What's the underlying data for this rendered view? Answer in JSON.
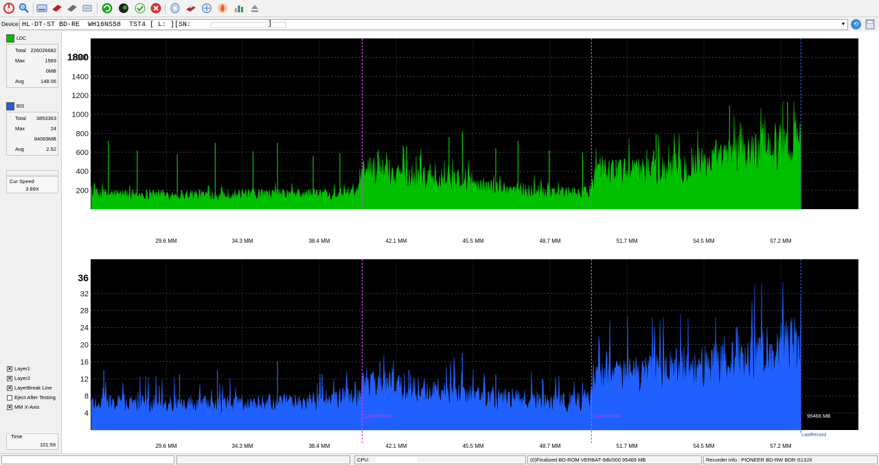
{
  "toolbar": {
    "buttons": [
      {
        "icon": "power-icon",
        "color": "#d43a2a"
      },
      {
        "icon": "find-icon",
        "color": "#3568c8"
      },
      {
        "icon": "drive-icon",
        "color": "#5577aa"
      },
      {
        "icon": "burn-disc-icon",
        "color": "#c02020"
      },
      {
        "icon": "erase-disc-icon",
        "color": "#707070"
      },
      {
        "icon": "copy-icon",
        "color": "#5a7fa8"
      },
      {
        "icon": "refresh-icon",
        "color": "#22a020"
      },
      {
        "icon": "earth-icon",
        "color": "#222222"
      },
      {
        "icon": "verify-icon",
        "color": "#3a9c3a"
      },
      {
        "icon": "stop-icon",
        "color": "#d83030"
      },
      {
        "icon": "disc-info-icon",
        "color": "#5580c0"
      },
      {
        "icon": "disc-quality-icon",
        "color": "#b03030"
      },
      {
        "icon": "scan-icon",
        "color": "#3070c0"
      },
      {
        "icon": "burn-icon",
        "color": "#e06020"
      },
      {
        "icon": "chart-icon",
        "color": "#e0a020"
      },
      {
        "icon": "eject-icon",
        "color": "#909090"
      }
    ]
  },
  "device": {
    "label": "Device:",
    "value": "HL-DT-ST BD-RE  WH16NS58  TST4 [ L: ][SN:",
    "close": "]"
  },
  "sidebar": {
    "ldc": {
      "label": "LDC",
      "color": "#00c000",
      "rows": [
        {
          "label": "Total",
          "value": "226026682"
        },
        {
          "label": "Max",
          "value": "1569"
        },
        {
          "label": "",
          "value": "0MB"
        },
        {
          "label": "Avg",
          "value": "148.06"
        }
      ]
    },
    "bis": {
      "label": "BIS",
      "color": "#2060e0",
      "rows": [
        {
          "label": "Total",
          "value": "3853363"
        },
        {
          "label": "Max",
          "value": "24"
        },
        {
          "label": "",
          "value": "84069MB"
        },
        {
          "label": "Avg",
          "value": "2.52"
        }
      ]
    },
    "cur_speed": {
      "label": "Cur Speed",
      "value": "3.89X"
    },
    "checkboxes": [
      {
        "label": "Layer1",
        "checked": true
      },
      {
        "label": "Layer2",
        "checked": true
      },
      {
        "label": "LayerBreak Line",
        "checked": true
      },
      {
        "label": "Eject After Testing",
        "checked": false
      },
      {
        "label": "MM X-Axis",
        "checked": true
      }
    ],
    "time": {
      "label": "Time",
      "value": "101:59"
    }
  },
  "chart_data": [
    {
      "type": "area",
      "series": [
        {
          "name": "LDC",
          "color": "#00c000"
        }
      ],
      "x_tick_labels": [
        "29.6 MM",
        "34.3 MM",
        "38.4 MM",
        "42.1 MM",
        "45.5 MM",
        "48.7 MM",
        "51.7 MM",
        "54.5 MM",
        "57.2 MM"
      ],
      "y_ticks": [
        200,
        400,
        600,
        800,
        1000,
        1200,
        1400,
        1600
      ],
      "y_top_label": "1800",
      "ylim": [
        0,
        1800
      ],
      "grid": true,
      "layer_breaks_mm": [
        38.4,
        48.7
      ],
      "last_record_mm": 58.1,
      "profile": {
        "x_mm": [
          25.6,
          28.0,
          32.0,
          36.0,
          38.2,
          38.5,
          40.0,
          42.0,
          44.0,
          46.0,
          48.6,
          48.9,
          50.0,
          52.0,
          54.0,
          56.0,
          58.1
        ],
        "baseline": [
          125,
          120,
          118,
          122,
          130,
          330,
          290,
          230,
          180,
          150,
          130,
          340,
          300,
          320,
          380,
          470,
          560
        ],
        "peaks": [
          {
            "x_mm": 27.0,
            "y": 720
          },
          {
            "x_mm": 28.3,
            "y": 620
          },
          {
            "x_mm": 30.1,
            "y": 580
          },
          {
            "x_mm": 31.8,
            "y": 700
          },
          {
            "x_mm": 33.5,
            "y": 610
          },
          {
            "x_mm": 34.6,
            "y": 700
          },
          {
            "x_mm": 36.2,
            "y": 560
          },
          {
            "x_mm": 37.4,
            "y": 590
          },
          {
            "x_mm": 39.1,
            "y": 600
          },
          {
            "x_mm": 40.4,
            "y": 660
          },
          {
            "x_mm": 41.0,
            "y": 560
          },
          {
            "x_mm": 42.3,
            "y": 760
          },
          {
            "x_mm": 42.9,
            "y": 820
          },
          {
            "x_mm": 44.4,
            "y": 640
          },
          {
            "x_mm": 45.4,
            "y": 720
          },
          {
            "x_mm": 46.8,
            "y": 620
          },
          {
            "x_mm": 48.3,
            "y": 600
          },
          {
            "x_mm": 49.8,
            "y": 520
          },
          {
            "x_mm": 51.6,
            "y": 790
          },
          {
            "x_mm": 53.2,
            "y": 640
          },
          {
            "x_mm": 54.3,
            "y": 730
          },
          {
            "x_mm": 54.9,
            "y": 1090
          },
          {
            "x_mm": 56.4,
            "y": 900
          },
          {
            "x_mm": 57.5,
            "y": 1130
          },
          {
            "x_mm": 57.8,
            "y": 960
          }
        ]
      }
    },
    {
      "type": "area",
      "series": [
        {
          "name": "BIS",
          "color": "#2060ff"
        }
      ],
      "x_tick_labels": [
        "29.6 MM",
        "34.3 MM",
        "38.4 MM",
        "42.1 MM",
        "45.5 MM",
        "48.7 MM",
        "51.7 MM",
        "54.5 MM",
        "57.2 MM"
      ],
      "y_ticks": [
        4,
        8,
        12,
        16,
        20,
        24,
        28,
        32
      ],
      "y_top_label": "36",
      "ylim": [
        0,
        40
      ],
      "grid": true,
      "layer_breaks_mm": [
        38.4,
        48.7
      ],
      "layer_break_label": "LayerBreak",
      "last_record_mm": 58.1,
      "end_value_label": "95466 MB",
      "last_record_label": "LastRecord",
      "profile": {
        "x_mm": [
          25.6,
          28.0,
          32.0,
          36.0,
          38.2,
          38.5,
          40.0,
          42.0,
          44.0,
          46.0,
          48.6,
          48.9,
          50.0,
          52.0,
          54.0,
          56.0,
          58.1
        ],
        "baseline": [
          5.5,
          5.2,
          5.0,
          5.5,
          6.5,
          9.5,
          8.5,
          7.5,
          6.5,
          5.8,
          5.5,
          10.5,
          10.8,
          11.5,
          12.5,
          14.5,
          17.0
        ],
        "peaks": [
          {
            "x_mm": 26.8,
            "y": 14
          },
          {
            "x_mm": 30.2,
            "y": 13
          },
          {
            "x_mm": 31.9,
            "y": 14
          },
          {
            "x_mm": 34.6,
            "y": 16
          },
          {
            "x_mm": 36.6,
            "y": 13
          },
          {
            "x_mm": 39.2,
            "y": 16
          },
          {
            "x_mm": 40.5,
            "y": 14
          },
          {
            "x_mm": 42.9,
            "y": 18
          },
          {
            "x_mm": 44.4,
            "y": 13
          },
          {
            "x_mm": 46.5,
            "y": 12
          },
          {
            "x_mm": 48.3,
            "y": 11
          },
          {
            "x_mm": 50.6,
            "y": 16
          },
          {
            "x_mm": 52.5,
            "y": 19
          },
          {
            "x_mm": 55.2,
            "y": 24
          },
          {
            "x_mm": 56.8,
            "y": 20
          },
          {
            "x_mm": 57.9,
            "y": 23
          }
        ]
      }
    }
  ],
  "status": {
    "cpu_label": "CPU:",
    "disc_info": "(0)Finalized  BD-ROM  VERBAT-IMk/000  95465 MB",
    "recorder_info": "Recorder info : PIONEER       BD-RW  BDR-S13JX"
  }
}
